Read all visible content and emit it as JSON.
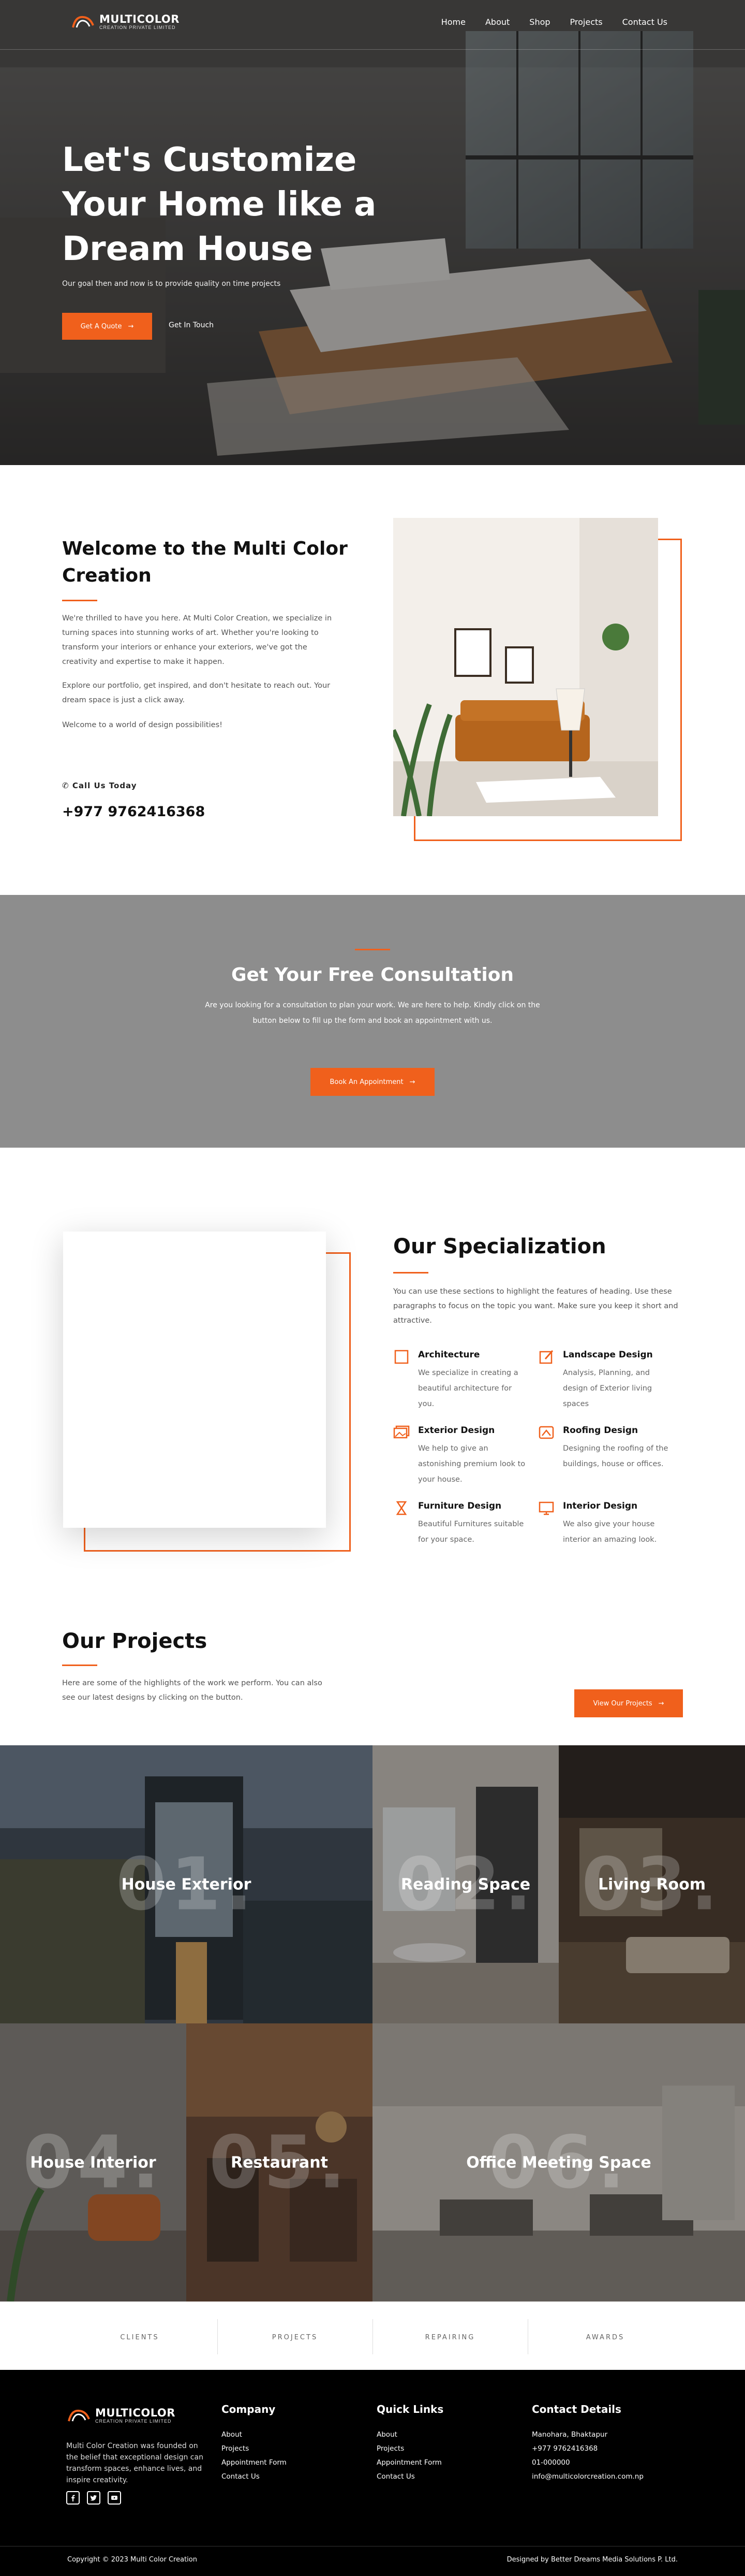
{
  "brand": {
    "name": "MULTICOLOR",
    "tagline": "CREATION PRIVATE LIMITED",
    "accent": "#f0601c"
  },
  "nav": {
    "links": [
      "Home",
      "About",
      "Shop",
      "Projects",
      "Contact Us"
    ]
  },
  "hero": {
    "title": "Let's Customize Your Home like a Dream House",
    "subtitle": "Our goal then and now is to provide quality on time projects",
    "primary_button": "Get A Quote",
    "secondary_link": "Get In Touch"
  },
  "welcome": {
    "title": "Welcome to the Multi Color Creation",
    "p1": "We're thrilled to have you here. At Multi Color Creation, we specialize in turning spaces into stunning works of art. Whether you're looking to transform your interiors or enhance your exteriors, we've got the creativity and expertise to make it happen.",
    "p2": "Explore our portfolio, get inspired, and don't hesitate to reach out. Your dream space is just a click away.",
    "p3": "Welcome to a world of design possibilities!",
    "call_label": "Call Us Today",
    "phone": "+977 9762416368"
  },
  "consultation": {
    "title": "Get Your Free Consultation",
    "text": "Are you looking for a consultation to plan your work. We are here to help. Kindly click on the button below to fill up the form and book an appointment with us.",
    "button": "Book An Appointment"
  },
  "specialization": {
    "title": "Our Specialization",
    "intro": "You can use these sections to highlight the features of heading. Use these paragraphs to focus on the topic you want. Make sure you keep it short and attractive.",
    "items": [
      {
        "name": "Architecture",
        "desc": "We specialize in creating a beautiful architecture for you.",
        "icon": "square-icon"
      },
      {
        "name": "Landscape Design",
        "desc": "Analysis, Planning, and design of Exterior living spaces",
        "icon": "pencil-box-icon"
      },
      {
        "name": "Exterior Design",
        "desc": "We help to give an astonishing premium look to your house.",
        "icon": "image-icon"
      },
      {
        "name": "Roofing Design",
        "desc": "Designing the roofing of the buildings, house or offices.",
        "icon": "roof-icon"
      },
      {
        "name": "Furniture Design",
        "desc": "Beautiful Furnitures suitable for your space.",
        "icon": "hourglass-icon"
      },
      {
        "name": "Interior Design",
        "desc": "We also give your house interior an amazing look.",
        "icon": "monitor-icon"
      }
    ]
  },
  "projects": {
    "title": "Our Projects",
    "text": "Here are some of the highlights of the work we perform. You can also see our latest designs by clicking on the button.",
    "button": "View Our Projects",
    "tiles": [
      {
        "num": "01.",
        "label": "House Exterior"
      },
      {
        "num": "02.",
        "label": "Reading Space"
      },
      {
        "num": "03.",
        "label": "Living Room"
      },
      {
        "num": "04.",
        "label": "House Interior"
      },
      {
        "num": "05.",
        "label": "Restaurant"
      },
      {
        "num": "06.",
        "label": "Office Meeting Space"
      }
    ]
  },
  "strip": [
    "CLIENTS",
    "PROJECTS",
    "REPAIRING",
    "AWARDS"
  ],
  "footer": {
    "about": "Multi Color Creation was founded on the belief that exceptional design can transform spaces, enhance lives, and inspire creativity.",
    "company_title": "Company",
    "company_links": [
      "About",
      "Projects",
      "Appointment Form",
      "Contact Us"
    ],
    "quick_title": "Quick Links",
    "quick_links": [
      "About",
      "Projects",
      "Appointment Form",
      "Contact Us"
    ],
    "contact_title": "Contact Details",
    "contact_lines": [
      "Manohara, Bhaktapur",
      "+977 9762416368",
      "01-000000",
      "info@multicolorcreation.com.np"
    ],
    "copyright": "Copyright © 2023 Multi Color Creation",
    "designed_by": "Designed by Better Dreams Media Solutions P. Ltd."
  }
}
